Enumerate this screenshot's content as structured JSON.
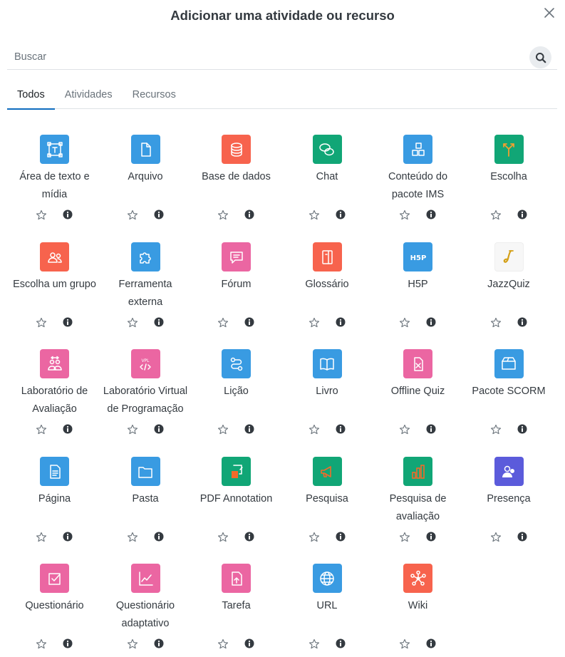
{
  "modal": {
    "title": "Adicionar uma atividade ou recurso",
    "close_icon": "close-icon"
  },
  "search": {
    "placeholder": "Buscar",
    "value": "",
    "icon": "search-icon"
  },
  "tabs": [
    {
      "label": "Todos",
      "active": true
    },
    {
      "label": "Atividades",
      "active": false
    },
    {
      "label": "Recursos",
      "active": false
    }
  ],
  "items": [
    {
      "label": "Área de texto e mídia",
      "icon": "text-area-icon",
      "color": "#399be2"
    },
    {
      "label": "Arquivo",
      "icon": "file-icon",
      "color": "#399be2"
    },
    {
      "label": "Base de dados",
      "icon": "database-icon",
      "color": "#f7634d"
    },
    {
      "label": "Chat",
      "icon": "chat-icon",
      "color": "#11a676"
    },
    {
      "label": "Conteúdo do pacote IMS",
      "icon": "ims-package-icon",
      "color": "#399be2"
    },
    {
      "label": "Escolha",
      "icon": "choice-icon",
      "color": "#11a676"
    },
    {
      "label": "Escolha um grupo",
      "icon": "group-choice-icon",
      "color": "#f7634d"
    },
    {
      "label": "Ferramenta externa",
      "icon": "puzzle-icon",
      "color": "#399be2"
    },
    {
      "label": "Fórum",
      "icon": "forum-icon",
      "color": "#eb66a2"
    },
    {
      "label": "Glossário",
      "icon": "glossary-icon",
      "color": "#f7634d"
    },
    {
      "label": "H5P",
      "icon": "h5p-icon",
      "color": "#399be2"
    },
    {
      "label": "JazzQuiz",
      "icon": "saxophone-icon",
      "color": "#f7f7f7"
    },
    {
      "label": "Laboratório de Avaliação",
      "icon": "workshop-icon",
      "color": "#eb66a2"
    },
    {
      "label": "Laboratório Virtual de Programação",
      "icon": "vpl-icon",
      "color": "#eb66a2"
    },
    {
      "label": "Lição",
      "icon": "lesson-icon",
      "color": "#399be2"
    },
    {
      "label": "Livro",
      "icon": "book-icon",
      "color": "#399be2"
    },
    {
      "label": "Offline Quiz",
      "icon": "offline-quiz-icon",
      "color": "#eb66a2"
    },
    {
      "label": "Pacote SCORM",
      "icon": "scorm-icon",
      "color": "#399be2"
    },
    {
      "label": "Página",
      "icon": "page-icon",
      "color": "#399be2"
    },
    {
      "label": "Pasta",
      "icon": "folder-icon",
      "color": "#399be2"
    },
    {
      "label": "PDF Annotation",
      "icon": "pdf-annotation-icon",
      "color": "#11a676"
    },
    {
      "label": "Pesquisa",
      "icon": "megaphone-icon",
      "color": "#11a676"
    },
    {
      "label": "Pesquisa de avaliação",
      "icon": "bar-chart-icon",
      "color": "#11a676"
    },
    {
      "label": "Presença",
      "icon": "attendance-icon",
      "color": "#5b5bdb"
    },
    {
      "label": "Questionário",
      "icon": "quiz-icon",
      "color": "#eb66a2"
    },
    {
      "label": "Questionário adaptativo",
      "icon": "adaptive-quiz-icon",
      "color": "#eb66a2"
    },
    {
      "label": "Tarefa",
      "icon": "assignment-icon",
      "color": "#eb66a2"
    },
    {
      "label": "URL",
      "icon": "globe-icon",
      "color": "#399be2"
    },
    {
      "label": "Wiki",
      "icon": "wiki-icon",
      "color": "#f7634d"
    }
  ],
  "actions": {
    "star_icon": "star-icon",
    "info_icon": "info-icon"
  }
}
